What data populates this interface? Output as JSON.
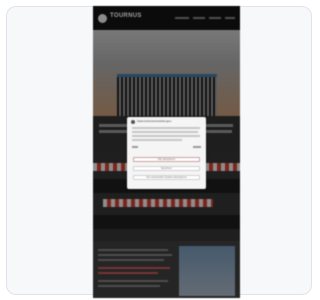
{
  "site": {
    "brand": "TOURNUS"
  },
  "cookie_dialog": {
    "title": "Datenschutzeinstellungen",
    "accept_all": "Alle akzeptieren",
    "save": "Speichern",
    "essential_only": "Nur essenzielle Cookies akzeptieren"
  }
}
